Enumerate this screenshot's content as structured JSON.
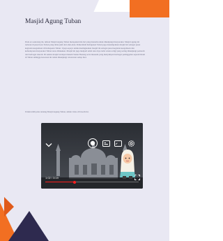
{
  "document": {
    "title": "Masjid Agung Tuban",
    "paragraph1": "Pada era sekarang ini, tulisan Masjid Agung Tuban merupakan hal-hal yang menarik untuk dikunjungi masyarakat. Masjid agung ini terletak di pusat kota Tuban yang tidak jauh dari alun-alun. Pemerintah Kabupaten Tuban juga menempatkan masjid ini sebagai pusat kegiatan keagamaan di Kabupaten Tuban. Upaya-upaya untuk meningkatkan masjid ini sebagai pusat kegiatan keagamaan dan kebudayaan masyarakat Tuban terus dilakukan. Masjid ini juga menjadi salah satu daya tarik wisata religi yang sering dikunjungi peziarah dari berbagai daerah. Di sekitar masjid terdapat makam Sunan Bonang serta museum yang menyimpan berbagai peninggalan sejarah Islam di Tuban sehingga kawasan ini ramai dikunjungi wisatawan setiap hari.",
    "paragraph2": "Untuk lebih jelas tentang Masjid Agung Tuban, simak video di bawah ini."
  },
  "video": {
    "time": "1:02 / 3:19",
    "progress": 0.31,
    "icons": [
      "chevron-down-icon",
      "play-toggle-icon",
      "captions-icon",
      "cast-icon",
      "settings-icon",
      "fullscreen-icon"
    ]
  },
  "colors": {
    "page_bg": "#e9e8f3",
    "accent_orange": "#f26f22",
    "deco_navy": "#2e2a4f",
    "progress": "#ff1f1f"
  }
}
